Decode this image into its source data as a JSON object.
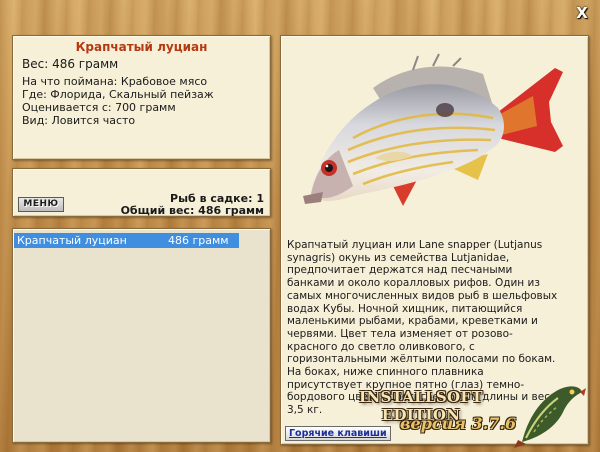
{
  "window": {
    "close_glyph": "X"
  },
  "fish": {
    "name": "Крапчатый луциан",
    "weight_line": "Вес: 486 грамм",
    "bait_line": "На что поймана: Крабовое мясо",
    "location_line": "Где: Флорида, Скальный пейзаж",
    "value_line": "Оценивается с: 700 грамм",
    "type_line": "Вид: Ловится часто",
    "description": "Крапчатый луциан или Lane snapper (Lutjanus synagris) окунь из семейства Lutjanidae, предпочитает держатся над песчаными банками и около коралловых рифов. Один из самых многочисленных видов рыб в шельфовых водах Кубы. Ночной хищник, питающийся маленькими рыбами, крабами, креветками и червями. Цвет тела изменяет от розово-красного до светло оливкового, с горизонтальными жёлтыми полосами по бокам. На боках, ниже спинного плавника присутствует крупное пятно (глаз) темно-бордового цвета. Достигает 60 см длины и веса 3,5 кг."
  },
  "summary": {
    "menu_label": "МЕНЮ",
    "count_line": "Рыб в садке: 1",
    "total_line": "Общий вес: 486 грамм"
  },
  "catch_list": [
    {
      "name": "Крапчатый луциан",
      "weight": "486 грамм"
    }
  ],
  "footer": {
    "hotkeys_label": "Горячие клавиши",
    "edition": "INSTALLSOFT EDITION",
    "version": "версия 3.7.6"
  },
  "colors": {
    "title": "#b53a12",
    "selection": "#3f8ee0",
    "panel": "#f7f0d8",
    "wood": "#c79a55"
  },
  "icons": [
    "close-icon",
    "fish-image",
    "pike-logo"
  ]
}
